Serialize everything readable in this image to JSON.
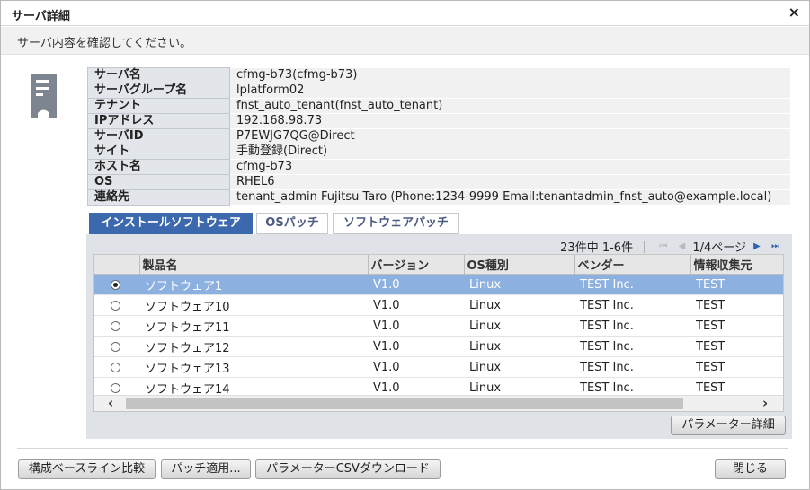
{
  "dialog": {
    "title": "サーバ詳細",
    "close_glyph": "×"
  },
  "message": "サーバ内容を確認してください。",
  "server_info": [
    {
      "label": "サーバ名",
      "value": "cfmg-b73(cfmg-b73)"
    },
    {
      "label": "サーバグループ名",
      "value": "lplatform02"
    },
    {
      "label": "テナント",
      "value": "fnst_auto_tenant(fnst_auto_tenant)"
    },
    {
      "label": "IPアドレス",
      "value": "192.168.98.73"
    },
    {
      "label": "サーバID",
      "value": "P7EWJG7QG@Direct"
    },
    {
      "label": "サイト",
      "value": "手動登録(Direct)"
    },
    {
      "label": "ホスト名",
      "value": "cfmg-b73"
    },
    {
      "label": "OS",
      "value": "RHEL6"
    },
    {
      "label": "連絡先",
      "value": "tenant_admin  Fujitsu Taro (Phone:1234-9999 Email:tenantadmin_fnst_auto@example.local)"
    }
  ],
  "tabs": [
    {
      "label": "インストールソフトウェア",
      "active": true
    },
    {
      "label": "OSパッチ",
      "active": false
    },
    {
      "label": "ソフトウェアパッチ",
      "active": false
    }
  ],
  "pager": {
    "count_text": "23件中 1-6件",
    "page_text": "1/4ページ",
    "first_glyph": "⏮",
    "prev_glyph": "◀",
    "next_glyph": "▶",
    "last_glyph": "⏭"
  },
  "grid": {
    "columns": [
      "製品名",
      "バージョン",
      "OS種別",
      "ベンダー",
      "情報収集元"
    ],
    "rows": [
      {
        "selected": true,
        "name": "ソフトウェア1",
        "version": "V1.0",
        "os": "Linux",
        "vendor": "TEST Inc.",
        "source": "TEST"
      },
      {
        "selected": false,
        "name": "ソフトウェア10",
        "version": "V1.0",
        "os": "Linux",
        "vendor": "TEST Inc.",
        "source": "TEST"
      },
      {
        "selected": false,
        "name": "ソフトウェア11",
        "version": "V1.0",
        "os": "Linux",
        "vendor": "TEST Inc.",
        "source": "TEST"
      },
      {
        "selected": false,
        "name": "ソフトウェア12",
        "version": "V1.0",
        "os": "Linux",
        "vendor": "TEST Inc.",
        "source": "TEST"
      },
      {
        "selected": false,
        "name": "ソフトウェア13",
        "version": "V1.0",
        "os": "Linux",
        "vendor": "TEST Inc.",
        "source": "TEST"
      },
      {
        "selected": false,
        "name": "ソフトウェア14",
        "version": "V1.0",
        "os": "Linux",
        "vendor": "TEST Inc.",
        "source": "TEST"
      }
    ],
    "scroll_left_glyph": "‹",
    "scroll_right_glyph": "›"
  },
  "buttons": {
    "param_detail": "パラメーター詳細",
    "baseline_compare": "構成ベースライン比較",
    "apply_patch": "パッチ適用...",
    "csv_download": "パラメーターCSVダウンロード",
    "close": "閉じる"
  },
  "colors": {
    "accent": "#3c69ae",
    "selected_row": "#8cb0e0",
    "label_cell": "#e2e6ea"
  },
  "icons": {
    "server": "server-icon"
  }
}
